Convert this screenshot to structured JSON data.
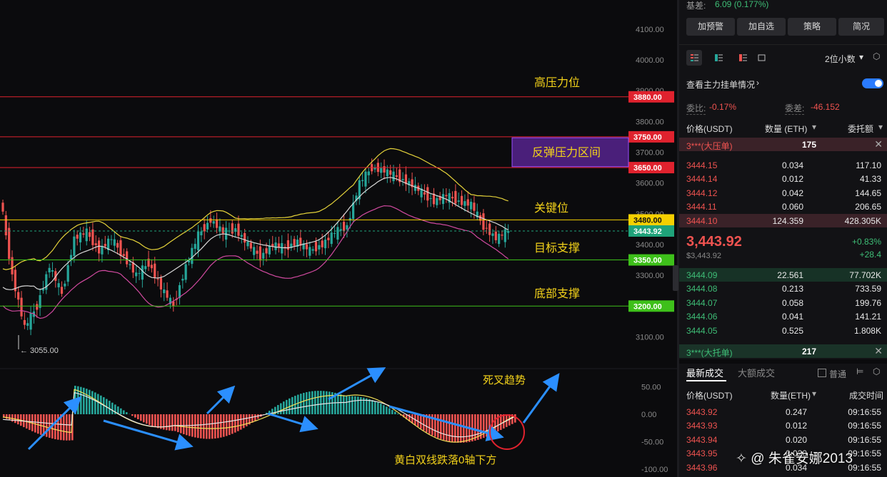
{
  "price_axis": {
    "ticks": [
      "4100.00",
      "4000.00",
      "3900.00",
      "3880.00",
      "3800.00",
      "3750.00",
      "3700.00",
      "3650.00",
      "3600.00",
      "3500.00",
      "3480.00",
      "3443.92",
      "3400.00",
      "3350.00",
      "3300.00",
      "3200.00",
      "3100.00"
    ],
    "low_marker": "← 3055.00"
  },
  "levels": [
    {
      "value": "3880.00",
      "label": "高压力位",
      "color": "#e0222e"
    },
    {
      "value": "3750.00",
      "label": "",
      "color": "#e0222e"
    },
    {
      "value": "3650.00",
      "label": "",
      "color": "#e0222e"
    },
    {
      "value": "3480.00",
      "label": "关键位",
      "color": "#f5d000"
    },
    {
      "value": "3443.92",
      "label": "",
      "color": "#1fa37a"
    },
    {
      "value": "3350.00",
      "label": "目标支撑",
      "color": "#3ec01a"
    },
    {
      "value": "3200.00",
      "label": "底部支撑",
      "color": "#3ec01a"
    }
  ],
  "annotations": {
    "high_resistance": "高压力位",
    "rebound_zone": "反弹压力区间",
    "key_level": "关键位",
    "target_support": "目标支撑",
    "bottom_support": "底部支撑",
    "death_cross": "死叉趋势",
    "macd_note": "黄白双线跌落0轴下方"
  },
  "macd_axis": {
    "ticks": [
      "50.00",
      "0.00",
      "-50.00",
      "-100.00"
    ]
  },
  "watermark": "@ 朱雀安娜2013",
  "colors": {
    "up": "#26a69a",
    "down": "#ef5350",
    "accent": "#2a7bff",
    "yellow": "#f5d000"
  },
  "panel": {
    "basis_label": "基差:",
    "basis_value": "6.09 (0.177%)",
    "buttons": [
      "加预警",
      "加自选",
      "策略",
      "简况"
    ],
    "decimal_select": "2位小数",
    "main_orders_link": "查看主力挂单情况",
    "ratio_label": "委比:",
    "ratio_value": "-0.17%",
    "diff_label": "委差:",
    "diff_value": "-46.152",
    "headers": {
      "price": "价格(USDT)",
      "qty": "数量 (ETH)",
      "amount": "委托额"
    },
    "big_ask": {
      "label": "3***(大压单)",
      "qty": "175"
    },
    "asks": [
      {
        "price": "3444.15",
        "qty": "0.034",
        "amount": "117.10"
      },
      {
        "price": "3444.14",
        "qty": "0.012",
        "amount": "41.33"
      },
      {
        "price": "3444.12",
        "qty": "0.042",
        "amount": "144.65"
      },
      {
        "price": "3444.11",
        "qty": "0.060",
        "amount": "206.65"
      },
      {
        "price": "3444.10",
        "qty": "124.359",
        "amount": "428.305K"
      }
    ],
    "last_price": "3,443.92",
    "last_price_usd": "$3,443.92",
    "change_pct": "+0.83%",
    "change_abs": "+28.4",
    "bids": [
      {
        "price": "3444.09",
        "qty": "22.561",
        "amount": "77.702K"
      },
      {
        "price": "3444.08",
        "qty": "0.213",
        "amount": "733.59"
      },
      {
        "price": "3444.07",
        "qty": "0.058",
        "amount": "199.76"
      },
      {
        "price": "3444.06",
        "qty": "0.041",
        "amount": "141.21"
      },
      {
        "price": "3444.05",
        "qty": "0.525",
        "amount": "1.808K"
      }
    ],
    "big_bid": {
      "label": "3***(大托单)",
      "qty": "217"
    },
    "tabs": {
      "latest": "最新成交",
      "large": "大额成交",
      "normal": "普通"
    },
    "trade_headers": {
      "price": "价格(USDT)",
      "qty": "数量(ETH)",
      "time": "成交时间"
    },
    "trades": [
      {
        "price": "3443.92",
        "qty": "0.247",
        "time": "09:16:55"
      },
      {
        "price": "3443.93",
        "qty": "0.012",
        "time": "09:16:55"
      },
      {
        "price": "3443.94",
        "qty": "0.020",
        "time": "09:16:55"
      },
      {
        "price": "3443.95",
        "qty": "0.020",
        "time": "09:16:55"
      },
      {
        "price": "3443.96",
        "qty": "0.034",
        "time": "09:16:55"
      }
    ]
  }
}
